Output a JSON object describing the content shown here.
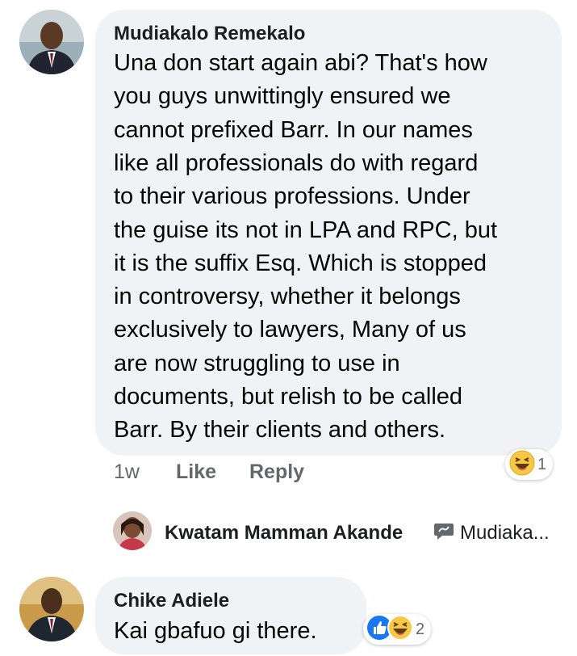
{
  "comment1": {
    "author": "Mudiakalo Remekalo",
    "lines": [
      "Una don start again abi? That's how",
      "you guys unwittingly ensured  we",
      "cannot prefixed Barr. In our names",
      "like all professionals do with regard",
      "to their various professions. Under",
      "the guise its not in LPA  and RPC, but",
      "it  is  the suffix Esq. Which is stopped",
      "in controversy, whether it belongs",
      "exclusively to lawyers,  Many of us",
      "are now struggling to use in",
      "documents, but relish to be called",
      "Barr. By their clients and others."
    ],
    "time": "1w",
    "like_label": "Like",
    "reply_label": "Reply",
    "reaction_icon": "haha-emoji-icon",
    "reaction_count": "1"
  },
  "reply_preview": {
    "author": "Kwatam Mamman Akande",
    "reply_icon": "reply-speech-icon",
    "text": "Mudiaka..."
  },
  "comment2": {
    "author": "Chike Adiele",
    "text": "Kai gbafuo gi there.",
    "reaction_icons": [
      "like-thumb-icon",
      "haha-emoji-icon"
    ],
    "reaction_count": "2"
  },
  "colors": {
    "bubble": "#f0f2f5",
    "meta": "#65676b",
    "like_blue": "#1877f2",
    "haha_yellow": "#f7c844"
  }
}
